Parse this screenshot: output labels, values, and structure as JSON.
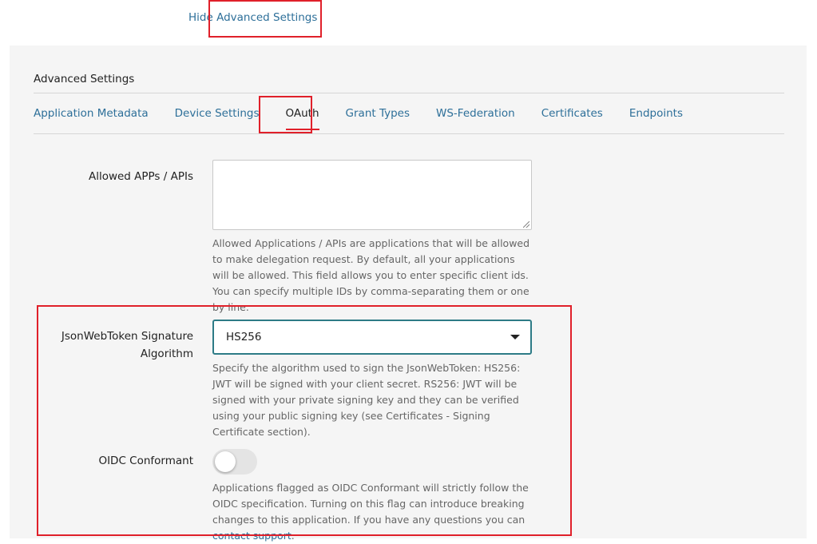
{
  "toggle_link": "Hide Advanced Settings",
  "panel": {
    "title": "Advanced Settings",
    "tabs": [
      {
        "label": "Application Metadata"
      },
      {
        "label": "Device Settings"
      },
      {
        "label": "OAuth"
      },
      {
        "label": "Grant Types"
      },
      {
        "label": "WS-Federation"
      },
      {
        "label": "Certificates"
      },
      {
        "label": "Endpoints"
      }
    ],
    "active_tab": "OAuth"
  },
  "allowed_apps": {
    "label": "Allowed APPs / APIs",
    "value": "",
    "help": "Allowed Applications / APIs are applications that will be allowed to make delegation request. By default, all your applications will be allowed. This field allows you to enter specific client ids. You can specify multiple IDs by comma-separating them or one by line."
  },
  "jwt_algorithm": {
    "label": "JsonWebToken Signature Algorithm",
    "selected": "HS256",
    "help": "Specify the algorithm used to sign the JsonWebToken: HS256: JWT will be signed with your client secret. RS256: JWT will be signed with your private signing key and they can be verified using your public signing key (see Certificates - Signing Certificate section)."
  },
  "oidc": {
    "label": "OIDC Conformant",
    "enabled": false,
    "help_prefix": "Applications flagged as OIDC Conformant will strictly follow the OIDC specification. Turning on this flag can introduce breaking changes to this application. If you have any questions you can ",
    "help_link": "contact support",
    "help_suffix": "."
  },
  "colors": {
    "link": "#2d6f99",
    "highlight": "#e0202a",
    "select_border": "#2d7b86",
    "panel_bg": "#f5f5f5"
  }
}
